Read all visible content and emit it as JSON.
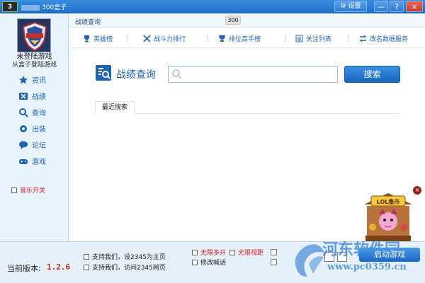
{
  "window": {
    "app_icon_text": "3",
    "title": "300盒子",
    "settings_label": "设置",
    "min_label": "—",
    "help_label": "?",
    "close_label": "×"
  },
  "sidebar": {
    "user_name": "未登陆游戏",
    "user_sub": "从盒子登陆游戏",
    "items": [
      {
        "label": "资讯",
        "icon": "star-icon"
      },
      {
        "label": "战绩",
        "icon": "crossed-swords-icon"
      },
      {
        "label": "查询",
        "icon": "search-icon"
      },
      {
        "label": "出装",
        "icon": "gear-items-icon"
      },
      {
        "label": "论坛",
        "icon": "chat-bubble-icon"
      },
      {
        "label": "游戏",
        "icon": "gamepad-icon"
      }
    ],
    "music_toggle": "音乐开关"
  },
  "header": {
    "page_title": "战绩查询",
    "count_badge": "300"
  },
  "navbar": {
    "links": [
      {
        "label": "英雄榜",
        "icon": "trophy-icon"
      },
      {
        "label": "战斗力排行",
        "icon": "crossed-swords-icon"
      },
      {
        "label": "排位高手榜",
        "icon": "cup-icon"
      },
      {
        "label": "关注列表",
        "icon": "list-icon"
      },
      {
        "label": "改名数据服务",
        "icon": "exchange-icon"
      }
    ]
  },
  "main": {
    "search_label": "战绩查询",
    "search_value": "",
    "search_button": "搜索",
    "recent_tab": "最近搜索"
  },
  "footer": {
    "version_label": "当前版本:",
    "version": "1.2.6",
    "options": [
      {
        "label": "支持我们，设2345为主页"
      },
      {
        "label": "支持我们，访问2345网页"
      }
    ],
    "toggles": [
      {
        "label": "无限多开",
        "red": true
      },
      {
        "label": "无限视距",
        "red": true
      },
      {
        "label": "修改喊话",
        "red": false
      }
    ],
    "start_button": "启动游戏",
    "mascot_sign": "LOL集市",
    "mascot_close": "×"
  },
  "watermark": {
    "text": "河东软件园",
    "url": "www.pc0359.cn"
  },
  "colors": {
    "accent": "#1e64b4",
    "titlebar": "#2a7ed6",
    "alert_red": "#d02020"
  }
}
